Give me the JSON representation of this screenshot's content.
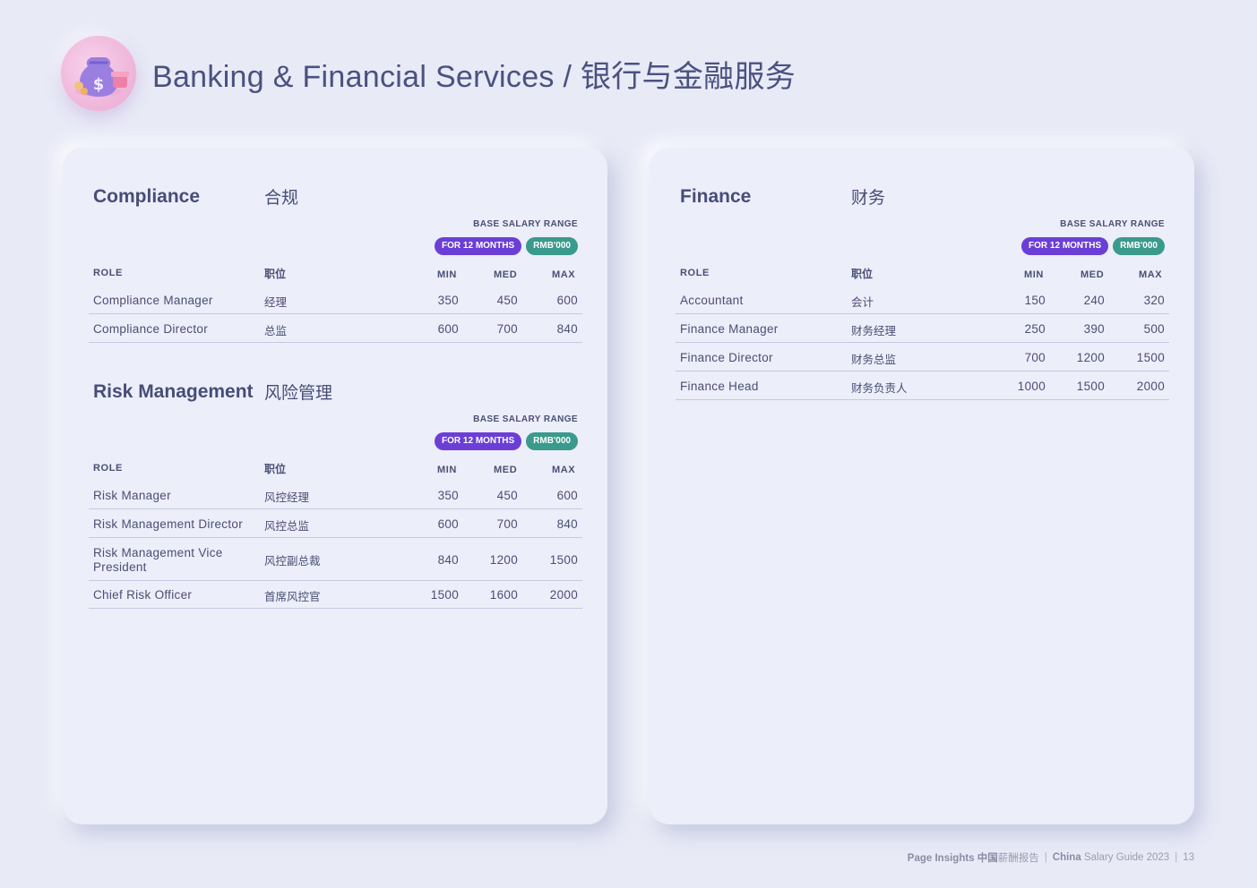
{
  "header": {
    "title": "Banking & Financial Services / 银行与金融服务",
    "logo_icon": "money-bag-icon"
  },
  "labels": {
    "range": "BASE SALARY RANGE",
    "months": "FOR 12 MONTHS",
    "currency": "RMB'000",
    "role": "ROLE",
    "role_zh": "职位",
    "min": "MIN",
    "med": "MED",
    "max": "MAX"
  },
  "compliance": {
    "title_en": "Compliance",
    "title_zh": "合规",
    "rows": [
      {
        "role": "Compliance Manager",
        "role_zh": "经理",
        "min": "350",
        "med": "450",
        "max": "600"
      },
      {
        "role": "Compliance Director",
        "role_zh": "总监",
        "min": "600",
        "med": "700",
        "max": "840"
      }
    ]
  },
  "risk": {
    "title_en": "Risk Management",
    "title_zh": "风险管理",
    "rows": [
      {
        "role": "Risk Manager",
        "role_zh": "风控经理",
        "min": "350",
        "med": "450",
        "max": "600"
      },
      {
        "role": "Risk Management Director",
        "role_zh": "风控总监",
        "min": "600",
        "med": "700",
        "max": "840"
      },
      {
        "role": "Risk Management Vice President",
        "role_zh": "风控副总裁",
        "min": "840",
        "med": "1200",
        "max": "1500"
      },
      {
        "role": "Chief Risk Officer",
        "role_zh": "首席风控官",
        "min": "1500",
        "med": "1600",
        "max": "2000"
      }
    ]
  },
  "finance": {
    "title_en": "Finance",
    "title_zh": "财务",
    "rows": [
      {
        "role": "Accountant",
        "role_zh": "会计",
        "min": "150",
        "med": "240",
        "max": "320"
      },
      {
        "role": "Finance Manager",
        "role_zh": "财务经理",
        "min": "250",
        "med": "390",
        "max": "500"
      },
      {
        "role": "Finance Director",
        "role_zh": "财务总监",
        "min": "700",
        "med": "1200",
        "max": "1500"
      },
      {
        "role": "Finance Head",
        "role_zh": "财务负责人",
        "min": "1000",
        "med": "1500",
        "max": "2000"
      }
    ]
  },
  "footer": {
    "brand": "Page Insights",
    "brand_zh_bold": "中国",
    "brand_zh": "薪酬报告",
    "guide_bold": "China",
    "guide": "Salary Guide 2023",
    "page": "13"
  },
  "colors": {
    "background": "#e8eaf6",
    "pill_purple": "#6b3fd6",
    "pill_teal": "#3a9a8c",
    "title": "#4b5180"
  }
}
